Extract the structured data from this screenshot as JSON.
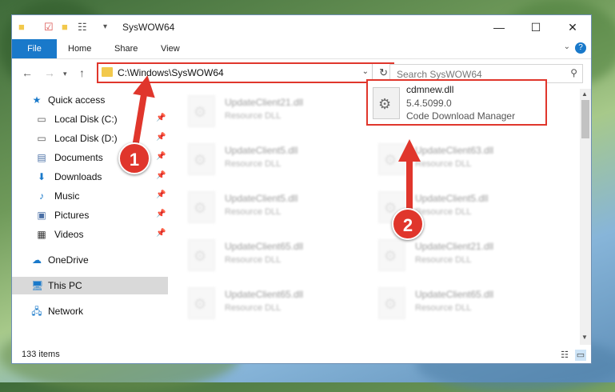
{
  "window": {
    "title": "SysWOW64",
    "minimize_glyph": "—",
    "maximize_glyph": "☐",
    "close_glyph": "✕"
  },
  "ribbon": {
    "file": "File",
    "tabs": [
      "Home",
      "Share",
      "View"
    ],
    "help_glyph": "?"
  },
  "address": {
    "path": "C:\\Windows\\SysWOW64"
  },
  "search": {
    "placeholder": "Search SysWOW64"
  },
  "sidebar": {
    "items": [
      {
        "label": "Quick access",
        "icon": "star-icon",
        "pinned": false
      },
      {
        "label": "Local Disk (C:)",
        "icon": "drive-icon",
        "pinned": true
      },
      {
        "label": "Local Disk (D:)",
        "icon": "drive-icon",
        "pinned": true
      },
      {
        "label": "Documents",
        "icon": "document-icon",
        "pinned": true
      },
      {
        "label": "Downloads",
        "icon": "download-icon",
        "pinned": true
      },
      {
        "label": "Music",
        "icon": "music-icon",
        "pinned": true
      },
      {
        "label": "Pictures",
        "icon": "picture-icon",
        "pinned": true
      },
      {
        "label": "Videos",
        "icon": "video-icon",
        "pinned": true
      },
      {
        "label": "OneDrive",
        "icon": "cloud-icon",
        "pinned": false
      },
      {
        "label": "This PC",
        "icon": "computer-icon",
        "pinned": false
      },
      {
        "label": "Network",
        "icon": "network-icon",
        "pinned": false
      }
    ]
  },
  "files": [
    {
      "name": "UpdateClient21.dll",
      "type": "Resource DLL"
    },
    {
      "name": "UpdateClient5.dll",
      "type": "Resource DLL"
    },
    {
      "name": "UpdateClient63.dll",
      "type": "Resource DLL"
    },
    {
      "name": "UpdateClient5.dll",
      "type": "Resource DLL"
    },
    {
      "name": "UpdateClient5.dll",
      "type": "Resource DLL"
    },
    {
      "name": "UpdateClient65.dll",
      "type": "Resource DLL"
    },
    {
      "name": "UpdateClient21.dll",
      "type": "Resource DLL"
    },
    {
      "name": "UpdateClient65.dll",
      "type": "Resource DLL"
    },
    {
      "name": "UpdateClient65.dll",
      "type": "Resource DLL"
    }
  ],
  "target_file": {
    "name": "cdmnew.dll",
    "version": "5.4.5099.0",
    "description": "Code Download Manager"
  },
  "status": {
    "item_count": "133 items"
  },
  "annotations": {
    "step1": "1",
    "step2": "2",
    "color": "#e0362c"
  }
}
